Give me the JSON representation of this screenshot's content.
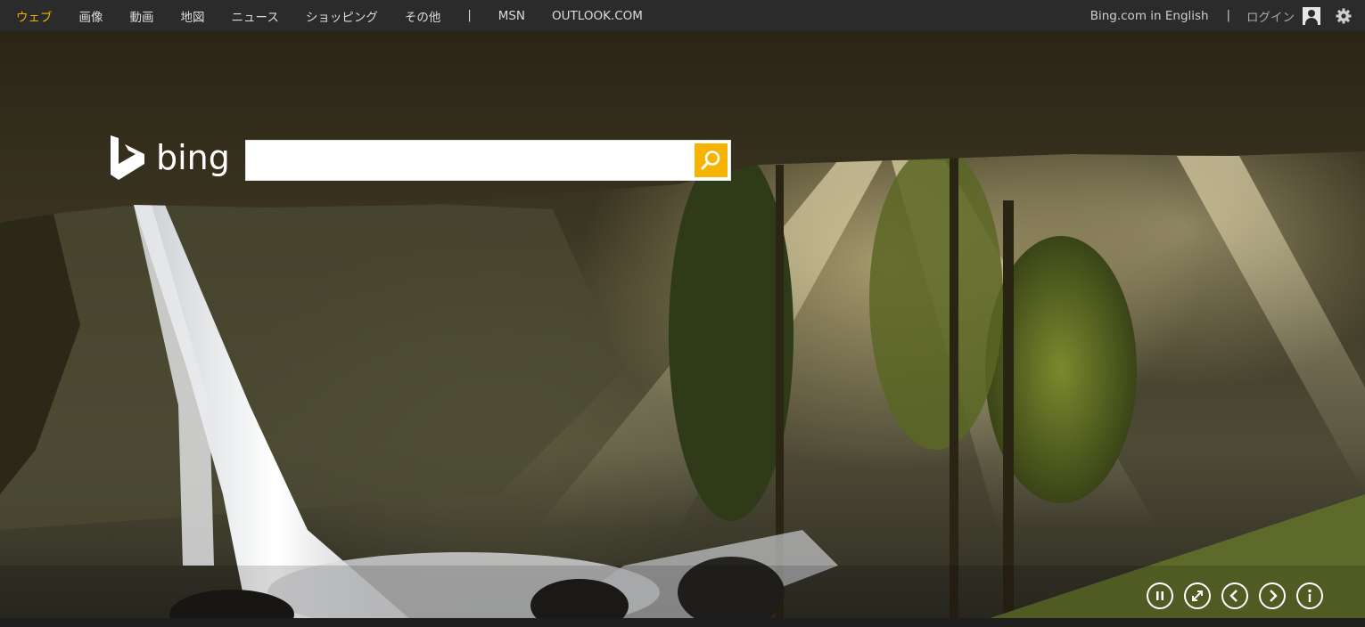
{
  "nav": {
    "left_items": [
      {
        "label": "ウェブ",
        "active": true
      },
      {
        "label": "画像"
      },
      {
        "label": "動画"
      },
      {
        "label": "地図"
      },
      {
        "label": "ニュース"
      },
      {
        "label": "ショッピング"
      },
      {
        "label": "その他"
      }
    ],
    "separator": "|",
    "external_links": [
      {
        "label": "MSN"
      },
      {
        "label": "OUTLOOK.COM"
      }
    ],
    "right": {
      "language_link": "Bing.com in English",
      "separator": "|",
      "login": "ログイン",
      "icons": [
        "user-icon",
        "gear-icon"
      ]
    }
  },
  "logo": {
    "text": "bing"
  },
  "search": {
    "value": "",
    "placeholder": "",
    "button_icon": "search-icon"
  },
  "controls": [
    "pause-icon",
    "expand-icon",
    "previous-icon",
    "next-icon",
    "info-icon"
  ],
  "colors": {
    "accent": "#f0b100",
    "search_button": "#f6b300",
    "topbar": "#2b2b2b"
  }
}
